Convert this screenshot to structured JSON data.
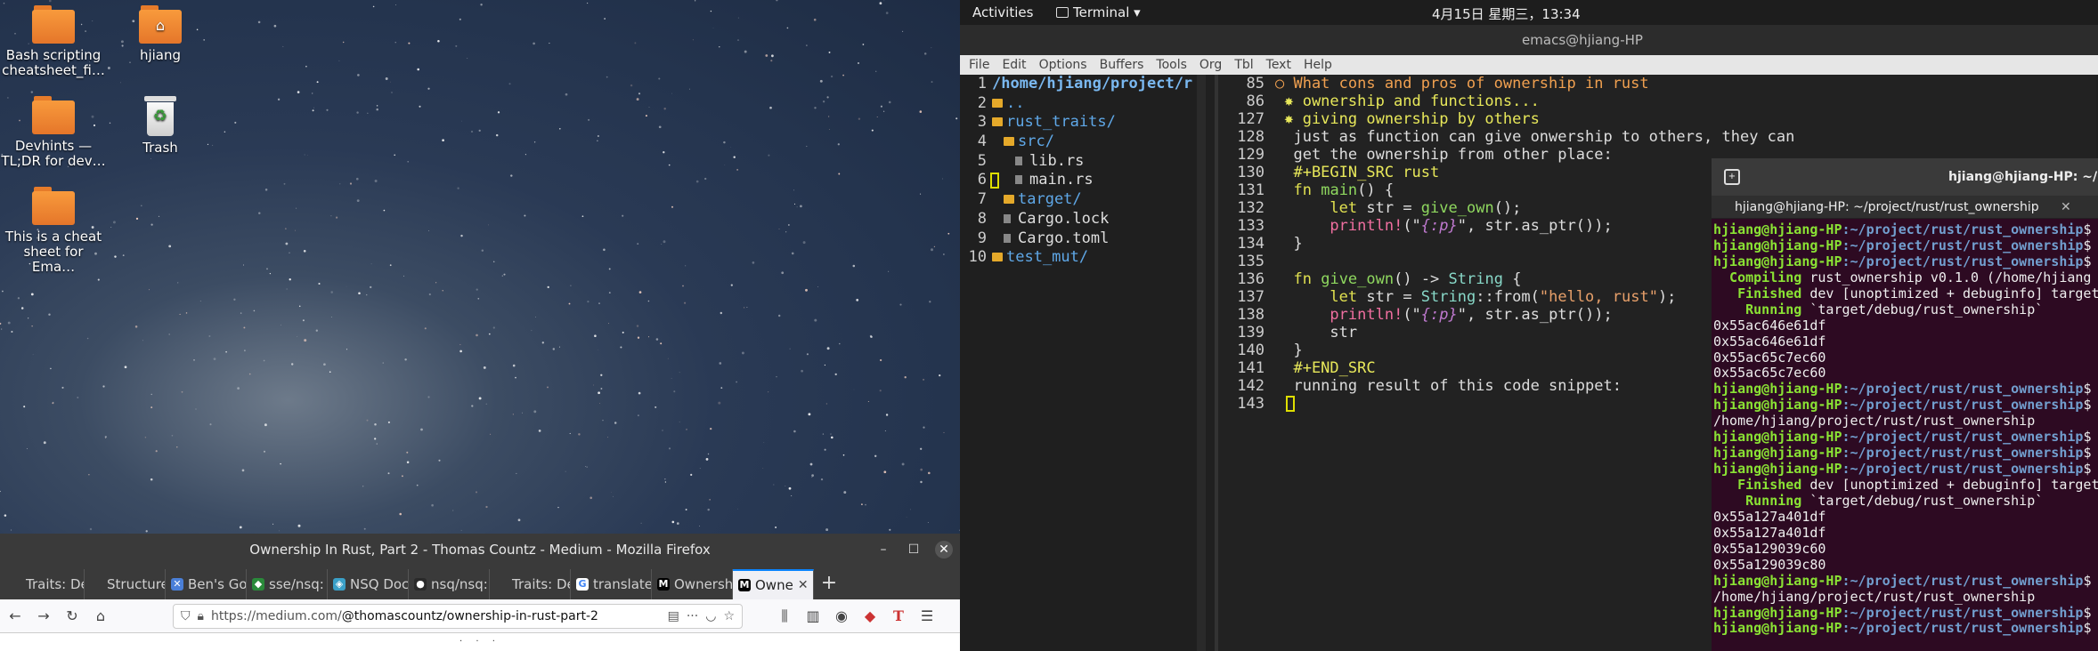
{
  "desktop": {
    "icons": [
      {
        "label": "Bash scripting cheatsheet_fi…",
        "kind": "folder"
      },
      {
        "label": "hjiang",
        "kind": "home-folder"
      },
      {
        "label": "Devhints — TL;DR for dev…",
        "kind": "folder"
      },
      {
        "label": "Trash",
        "kind": "trash"
      },
      {
        "label": "This is a cheat sheet for Ema…",
        "kind": "folder"
      }
    ]
  },
  "firefox": {
    "title": "Ownership In Rust, Part 2 - Thomas Countz - Medium - Mozilla Firefox",
    "tabs": [
      {
        "label": "Traits: De",
        "fav": "",
        "color": "#3a3a3a"
      },
      {
        "label": "Structure",
        "fav": "",
        "color": "#3a3a3a"
      },
      {
        "label": "Ben's Go",
        "fav": "✕",
        "color": "#4a7fd8"
      },
      {
        "label": "sse/nsq:",
        "fav": "◆",
        "color": "#2a8a3a"
      },
      {
        "label": "NSQ Doc",
        "fav": "◈",
        "color": "#3aa0c8"
      },
      {
        "label": "nsq/nsq:",
        "fav": "●",
        "color": "#2a2a2a"
      },
      {
        "label": "Traits: De",
        "fav": "",
        "color": "#3a3a3a"
      },
      {
        "label": "translate",
        "fav": "G",
        "color": "#ffffff"
      },
      {
        "label": "Ownersh",
        "fav": "M",
        "color": "#000000"
      },
      {
        "label": "Owne",
        "fav": "M",
        "color": "#000000",
        "active": true
      }
    ],
    "url_prefix": "https://medium.com/",
    "url_rest": "@thomascountz/ownership-in-rust-part-2",
    "content_dots": "· · ·"
  },
  "topbar": {
    "activities": "Activities",
    "app": "Terminal ▾",
    "clock": "4月15日 星期三，13:34"
  },
  "emacs": {
    "title": "emacs@hjiang-HP",
    "menu": [
      "File",
      "Edit",
      "Options",
      "Buffers",
      "Tools",
      "Org",
      "Tbl",
      "Text",
      "Help"
    ],
    "tree": [
      {
        "n": "1",
        "text": "/home/hjiang/project/r",
        "cls": "dirhead",
        "icon": ""
      },
      {
        "n": "2",
        "text": "..",
        "cls": "dir",
        "icon": "dir",
        "indent": 0
      },
      {
        "n": "3",
        "text": "rust_traits/",
        "cls": "dir",
        "icon": "dir",
        "indent": 0
      },
      {
        "n": "4",
        "text": "src/",
        "cls": "dir",
        "icon": "dir",
        "indent": 1
      },
      {
        "n": "5",
        "text": "lib.rs",
        "cls": "",
        "icon": "file",
        "indent": 2
      },
      {
        "n": "6",
        "text": "main.rs",
        "cls": "",
        "icon": "file",
        "indent": 2
      },
      {
        "n": "7",
        "text": "target/",
        "cls": "dir",
        "icon": "dir",
        "indent": 1
      },
      {
        "n": "8",
        "text": "Cargo.lock",
        "cls": "",
        "icon": "file",
        "indent": 1
      },
      {
        "n": "9",
        "text": "Cargo.toml",
        "cls": "",
        "icon": "file",
        "indent": 1
      },
      {
        "n": "10",
        "text": "test_mut/",
        "cls": "dir",
        "icon": "dir",
        "indent": 0
      }
    ],
    "code": [
      {
        "n": "85",
        "t": "○ What cons and pros of ownership in rust"
      },
      {
        "n": "86",
        "t": " ✸ ownership and functions..."
      },
      {
        "n": "127",
        "t": " ✸ giving ownership by others"
      },
      {
        "n": "128",
        "t": "  just as function can give onwership to others, they can"
      },
      {
        "n": "129",
        "t": "  get the ownership from other place:"
      },
      {
        "n": "130",
        "t": "  #+BEGIN_SRC rust"
      },
      {
        "n": "131",
        "t": "  fn main() {"
      },
      {
        "n": "132",
        "t": "      let str = give_own();"
      },
      {
        "n": "133",
        "t": "      println!(\"{:p}\", str.as_ptr());"
      },
      {
        "n": "134",
        "t": "  }"
      },
      {
        "n": "135",
        "t": ""
      },
      {
        "n": "136",
        "t": "  fn give_own() -> String {"
      },
      {
        "n": "137",
        "t": "      let str = String::from(\"hello, rust\");"
      },
      {
        "n": "138",
        "t": "      println!(\"{:p}\", str.as_ptr());"
      },
      {
        "n": "139",
        "t": "      str"
      },
      {
        "n": "140",
        "t": "  }"
      },
      {
        "n": "141",
        "t": "  #+END_SRC"
      },
      {
        "n": "142",
        "t": "  running result of this code snippet:"
      },
      {
        "n": "143",
        "t": ""
      }
    ]
  },
  "terminal": {
    "title": "hjiang@hjiang-HP: ~/pro",
    "tab": "hjiang@hjiang-HP: ~/project/rust/rust_ownership",
    "tab_close": "✕",
    "lines": [
      {
        "type": "prompt",
        "user": "hjiang@hjiang-HP",
        "path": ":~/project/rust/rust_ownership",
        "rest": "$"
      },
      {
        "type": "prompt",
        "user": "hjiang@hjiang-HP",
        "path": ":~/project/rust/rust_ownership",
        "rest": "$"
      },
      {
        "type": "prompt",
        "user": "hjiang@hjiang-HP",
        "path": ":~/project/rust/rust_ownership",
        "rest": "$"
      },
      {
        "type": "cargo",
        "head": "  Compiling",
        "rest": " rust_ownership v0.1.0 (/home/hjiang"
      },
      {
        "type": "cargo",
        "head": "   Finished",
        "rest": " dev [unoptimized + debuginfo] target"
      },
      {
        "type": "cargo",
        "head": "    Running",
        "rest": " `target/debug/rust_ownership`"
      },
      {
        "type": "plain",
        "text": "0x55ac646e61df"
      },
      {
        "type": "plain",
        "text": "0x55ac646e61df"
      },
      {
        "type": "plain",
        "text": "0x55ac65c7ec60"
      },
      {
        "type": "plain",
        "text": "0x55ac65c7ec60"
      },
      {
        "type": "prompt",
        "user": "hjiang@hjiang-HP",
        "path": ":~/project/rust/rust_ownership",
        "rest": "$"
      },
      {
        "type": "prompt",
        "user": "hjiang@hjiang-HP",
        "path": ":~/project/rust/rust_ownership",
        "rest": "$"
      },
      {
        "type": "plain",
        "text": "/home/hjiang/project/rust/rust_ownership"
      },
      {
        "type": "prompt",
        "user": "hjiang@hjiang-HP",
        "path": ":~/project/rust/rust_ownership",
        "rest": "$"
      },
      {
        "type": "prompt",
        "user": "hjiang@hjiang-HP",
        "path": ":~/project/rust/rust_ownership",
        "rest": "$"
      },
      {
        "type": "prompt",
        "user": "hjiang@hjiang-HP",
        "path": ":~/project/rust/rust_ownership",
        "rest": "$"
      },
      {
        "type": "cargo",
        "head": "   Finished",
        "rest": " dev [unoptimized + debuginfo] target"
      },
      {
        "type": "cargo",
        "head": "    Running",
        "rest": " `target/debug/rust_ownership`"
      },
      {
        "type": "plain",
        "text": "0x55a127a401df"
      },
      {
        "type": "plain",
        "text": "0x55a127a401df"
      },
      {
        "type": "plain",
        "text": "0x55a129039c60"
      },
      {
        "type": "plain",
        "text": "0x55a129039c80"
      },
      {
        "type": "prompt",
        "user": "hjiang@hjiang-HP",
        "path": ":~/project/rust/rust_ownership",
        "rest": "$"
      },
      {
        "type": "plain",
        "text": "/home/hjiang/project/rust/rust_ownership"
      },
      {
        "type": "prompt",
        "user": "hjiang@hjiang-HP",
        "path": ":~/project/rust/rust_ownership",
        "rest": "$"
      },
      {
        "type": "prompt",
        "user": "hjiang@hjiang-HP",
        "path": ":~/project/rust/rust_ownership",
        "rest": "$"
      }
    ]
  }
}
